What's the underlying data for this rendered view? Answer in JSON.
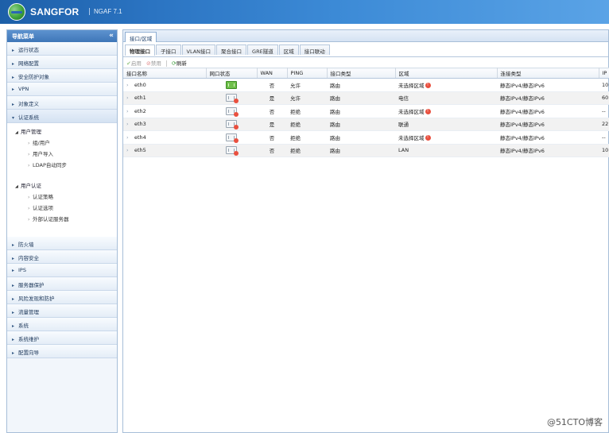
{
  "header": {
    "brand": "SANGFOR",
    "product": "NGAF 7.1"
  },
  "sidebar": {
    "title": "导航菜单",
    "collapse_icon": "double-chevron-left-icon",
    "top_items": [
      {
        "label": "运行状态"
      },
      {
        "label": "网络配置"
      },
      {
        "label": "安全防护对象"
      },
      {
        "label": "VPN"
      },
      {
        "label": "对象定义"
      }
    ],
    "open_item": {
      "label": "认证系统"
    },
    "tree": {
      "group1": {
        "label": "用户管理",
        "leaves": [
          "组/用户",
          "用户导入",
          "LDAP自动同步"
        ]
      },
      "group2": {
        "label": "用户认证",
        "leaves": [
          "认证策略",
          "认证选项",
          "外部认证服务器"
        ]
      }
    },
    "bottom_items": [
      {
        "label": "防火墙"
      },
      {
        "label": "内容安全"
      },
      {
        "label": "IPS"
      },
      {
        "label": "服务器保护"
      },
      {
        "label": "风险发现和防护"
      },
      {
        "label": "流量管理"
      },
      {
        "label": "系统"
      },
      {
        "label": "系统维护"
      },
      {
        "label": "配置向导"
      }
    ]
  },
  "main": {
    "tab": "接口/区域",
    "subtabs": [
      "物理接口",
      "子接口",
      "VLAN接口",
      "聚合接口",
      "GRE隧道",
      "区域",
      "接口联动"
    ],
    "active_subtab": "物理接口",
    "toolbar": {
      "enable": "启用",
      "disable": "禁用",
      "refresh": "刷新"
    },
    "columns": [
      "接口名称",
      "网口状态",
      "WAN",
      "PING",
      "接口类型",
      "区域",
      "连接类型",
      "IP"
    ],
    "rows": [
      {
        "name": "eth0",
        "status": "up",
        "wan": "否",
        "ping": "允许",
        "type": "路由",
        "zone": "未选择区域",
        "zone_unset": true,
        "conn": "静态IPv4/静态IPv6",
        "ip": "10"
      },
      {
        "name": "eth1",
        "status": "down",
        "wan": "是",
        "ping": "允许",
        "type": "路由",
        "zone": "电信",
        "zone_unset": false,
        "conn": "静态IPv4/静态IPv6",
        "ip": "60"
      },
      {
        "name": "eth2",
        "status": "down",
        "wan": "否",
        "ping": "拒绝",
        "type": "路由",
        "zone": "未选择区域",
        "zone_unset": true,
        "conn": "静态IPv4/静态IPv6",
        "ip": "--"
      },
      {
        "name": "eth3",
        "status": "down",
        "wan": "是",
        "ping": "拒绝",
        "type": "路由",
        "zone": "联通",
        "zone_unset": false,
        "conn": "静态IPv4/静态IPv6",
        "ip": "22"
      },
      {
        "name": "eth4",
        "status": "down",
        "wan": "否",
        "ping": "拒绝",
        "type": "路由",
        "zone": "未选择区域",
        "zone_unset": true,
        "conn": "静态IPv4/静态IPv6",
        "ip": "--"
      },
      {
        "name": "eth5",
        "status": "down",
        "wan": "否",
        "ping": "拒绝",
        "type": "路由",
        "zone": "LAN",
        "zone_unset": false,
        "conn": "静态IPv4/静态IPv6",
        "ip": "10"
      }
    ]
  },
  "watermark": "@51CTO博客"
}
